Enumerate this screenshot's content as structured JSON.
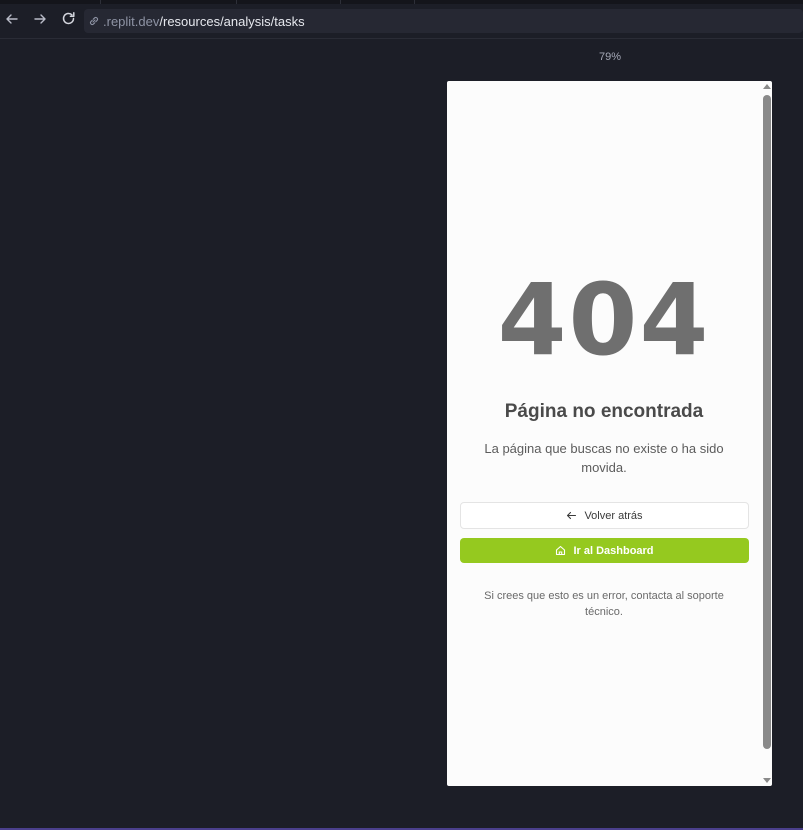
{
  "browser": {
    "url_host": ".replit.dev",
    "url_path": "/resources/analysis/tasks",
    "zoom": "79%",
    "icons": {
      "back": "arrow-left-icon",
      "forward": "arrow-right-icon",
      "reload": "reload-icon",
      "link": "link-icon"
    }
  },
  "page": {
    "error_code": "404",
    "title": "Página no encontrada",
    "description": "La página que buscas no existe o ha sido movida.",
    "back_button_label": "Volver atrás",
    "dashboard_button_label": "Ir al Dashboard",
    "support_note": "Si crees que esto es un error, contacta al soporte técnico.",
    "colors": {
      "accent": "#95c91f",
      "error_code": "#6f6f6f",
      "background": "#fcfcfc"
    }
  }
}
